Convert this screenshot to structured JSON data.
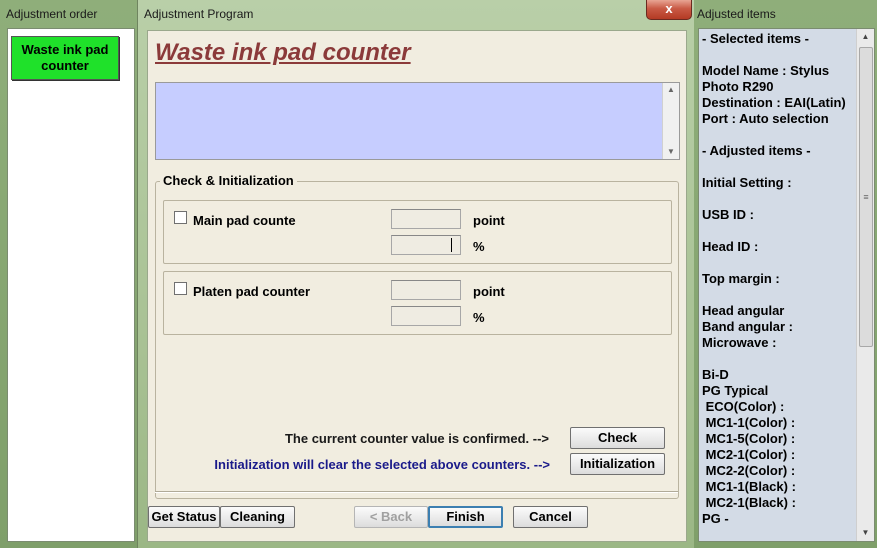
{
  "left_window": {
    "title": "Adjustment order",
    "selected_item": "Waste ink pad counter"
  },
  "main_window": {
    "title": "Adjustment Program",
    "close_glyph": "x",
    "page_title": "Waste ink pad counter",
    "group_label": "Check & Initialization",
    "main_pad": {
      "label": "Main pad counte",
      "unit_point": "point",
      "unit_percent": "%"
    },
    "platen_pad": {
      "label": "Platen pad counter",
      "unit_point": "point",
      "unit_percent": "%"
    },
    "confirm_text": "The current counter value is confirmed. -->",
    "check_button": "Check",
    "init_text": "Initialization will clear the selected above counters. -->",
    "init_button": "Initialization",
    "get_status_button": "Get Status",
    "cleaning_button": "Cleaning",
    "back_button": "< Back",
    "finish_button": "Finish",
    "cancel_button": "Cancel"
  },
  "right_window": {
    "title": "Adjusted items",
    "lines": [
      "- Selected items -",
      "",
      "Model Name : Stylus",
      "Photo R290",
      "Destination : EAI(Latin)",
      "Port : Auto selection",
      "",
      "- Adjusted items -",
      "",
      "Initial Setting :",
      "",
      "USB ID :",
      "",
      "Head ID :",
      "",
      "Top margin :",
      "",
      "Head angular",
      "Band angular :",
      "Microwave :",
      "",
      "Bi-D",
      "PG Typical",
      " ECO(Color)  :",
      " MC1-1(Color) :",
      " MC1-5(Color) :",
      " MC2-1(Color) :",
      " MC2-2(Color) :",
      " MC1-1(Black) :",
      " MC2-1(Black) :",
      "PG -"
    ]
  },
  "icons": {
    "scroll_up": "up-arrow-icon",
    "scroll_down": "down-arrow-icon",
    "close": "close-icon",
    "checkbox": "checkbox-icon"
  },
  "colors": {
    "selected_item_bg": "#1fe12a",
    "page_title": "#8b3a3a",
    "message_box_bg": "#c6cdff",
    "init_text": "#1a1a8a",
    "close_button": "#c95a45"
  }
}
